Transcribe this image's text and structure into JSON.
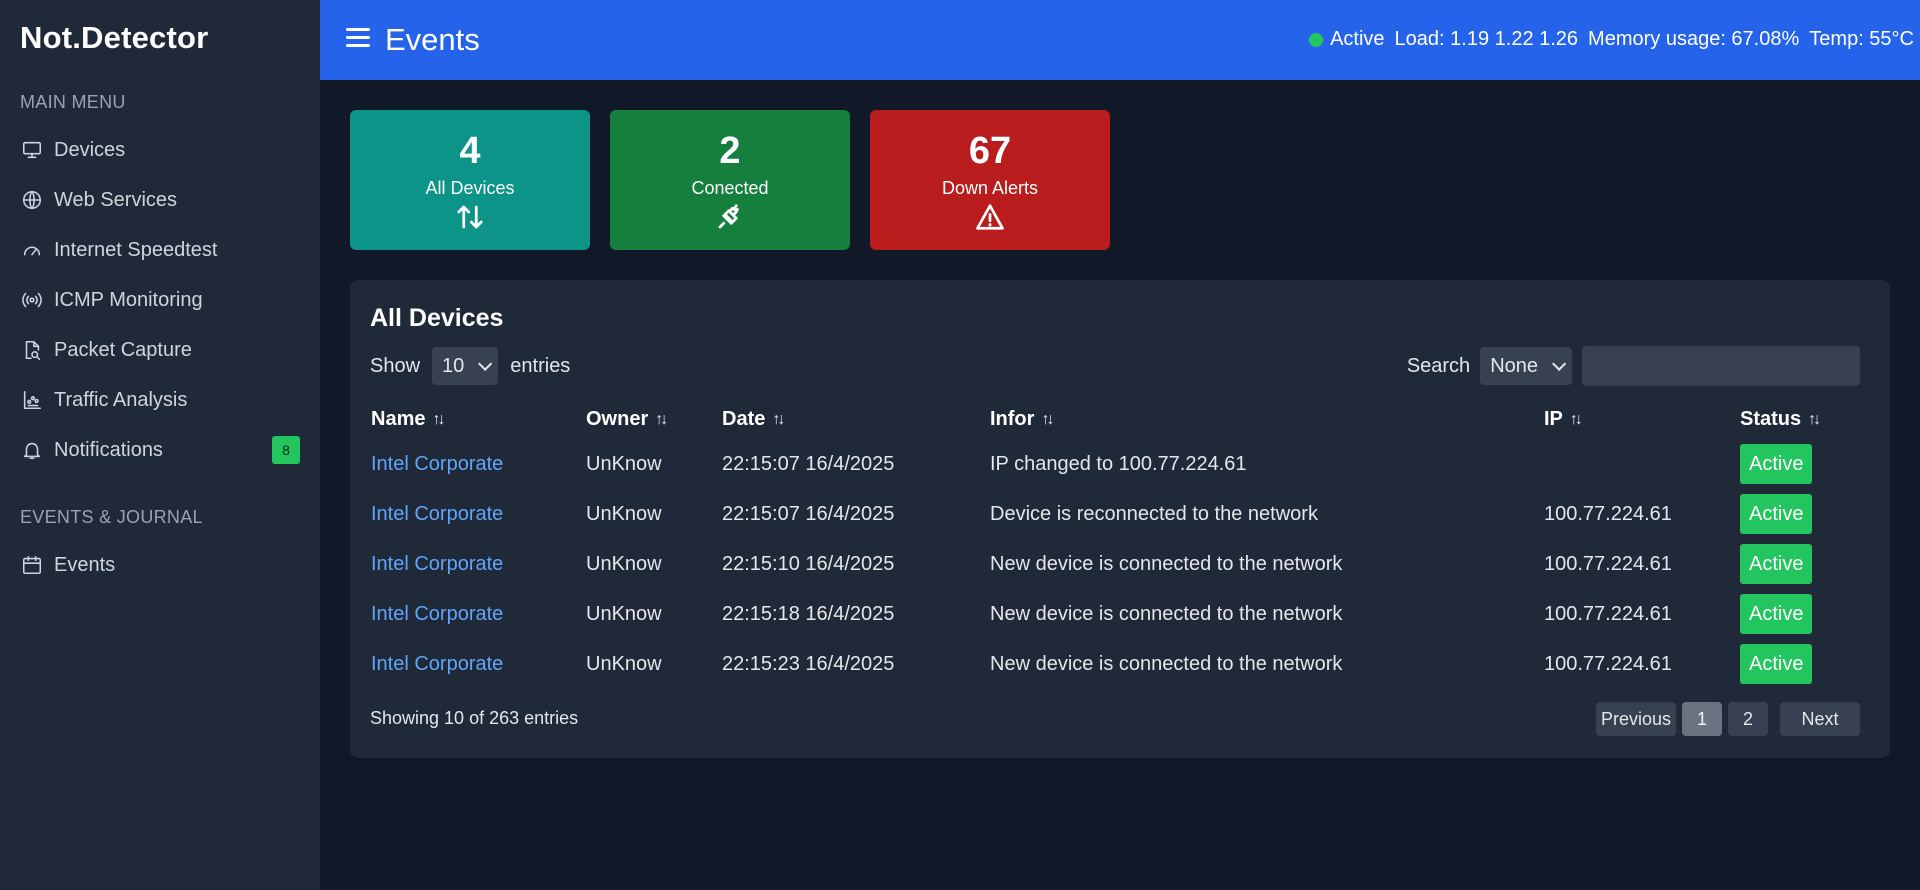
{
  "sidebar": {
    "brand": "Not.Detector",
    "main_menu_label": "MAIN MENU",
    "items": [
      {
        "label": "Devices",
        "icon": "monitor-icon"
      },
      {
        "label": "Web Services",
        "icon": "globe-icon"
      },
      {
        "label": "Internet Speedtest",
        "icon": "gauge-icon"
      },
      {
        "label": "ICMP Monitoring",
        "icon": "broadcast-icon"
      },
      {
        "label": "Packet Capture",
        "icon": "file-search-icon"
      },
      {
        "label": "Traffic Analysis",
        "icon": "chart-icon"
      },
      {
        "label": "Notifications",
        "icon": "bell-icon",
        "badge": "8"
      }
    ],
    "events_label": "EVENTS & JOURNAL",
    "events_items": [
      {
        "label": "Events",
        "icon": "calendar-icon"
      }
    ]
  },
  "header": {
    "title": "Events",
    "status": "Active",
    "load": "Load: 1.19 1.22 1.26",
    "memory": "Memory usage: 67.08%",
    "temp": "Temp: 55°C"
  },
  "cards": [
    {
      "value": "4",
      "label": "All Devices",
      "icon": "arrows-up-down-icon",
      "color": "#0d9488"
    },
    {
      "value": "2",
      "label": "Conected",
      "icon": "plug-icon",
      "color": "#15803d"
    },
    {
      "value": "67",
      "label": "Down Alerts",
      "icon": "warning-icon",
      "color": "#b91c1c"
    }
  ],
  "table": {
    "title": "All Devices",
    "show_label": "Show",
    "page_size": "10",
    "entries_label": "entries",
    "search_label": "Search",
    "search_filter": "None",
    "search_value": "",
    "columns": [
      "Name",
      "Owner",
      "Date",
      "Infor",
      "IP",
      "Status"
    ],
    "rows": [
      {
        "name": "Intel Corporate",
        "owner": "UnKnow",
        "date": "22:15:07 16/4/2025",
        "info": "IP changed to 100.77.224.61",
        "ip": "",
        "status": "Active"
      },
      {
        "name": "Intel Corporate",
        "owner": "UnKnow",
        "date": "22:15:07 16/4/2025",
        "info": "Device is reconnected to the network",
        "ip": "100.77.224.61",
        "status": "Active"
      },
      {
        "name": "Intel Corporate",
        "owner": "UnKnow",
        "date": "22:15:10 16/4/2025",
        "info": "New device is connected to the network",
        "ip": "100.77.224.61",
        "status": "Active"
      },
      {
        "name": "Intel Corporate",
        "owner": "UnKnow",
        "date": "22:15:18 16/4/2025",
        "info": "New device is connected to the network",
        "ip": "100.77.224.61",
        "status": "Active"
      },
      {
        "name": "Intel Corporate",
        "owner": "UnKnow",
        "date": "22:15:23 16/4/2025",
        "info": "New device is connected to the network",
        "ip": "100.77.224.61",
        "status": "Active"
      }
    ],
    "footer": "Showing 10 of 263 entries",
    "pagination": {
      "previous": "Previous",
      "pages": [
        "1",
        "2"
      ],
      "current": "1",
      "next": "Next"
    }
  },
  "colors": {
    "accent": "#2563eb",
    "status_active": "#22c55e",
    "link": "#60a5fa"
  }
}
